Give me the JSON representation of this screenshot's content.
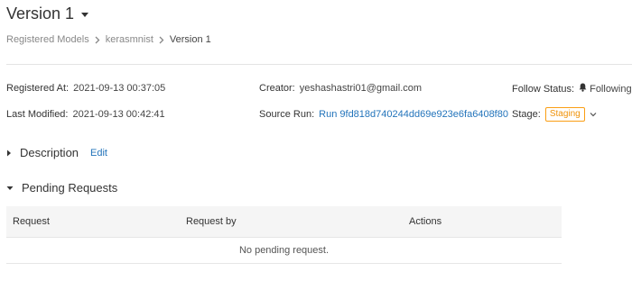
{
  "header": {
    "title": "Version 1"
  },
  "breadcrumb": {
    "items": [
      "Registered Models",
      "kerasmnist",
      "Version 1"
    ]
  },
  "metadata": {
    "registered_at": {
      "label": "Registered At:",
      "value": "2021-09-13 00:37:05"
    },
    "last_modified": {
      "label": "Last Modified:",
      "value": "2021-09-13 00:42:41"
    },
    "creator": {
      "label": "Creator:",
      "value": "yeshashastri01@gmail.com"
    },
    "source_run": {
      "label": "Source Run:",
      "value": "Run 9fd818d740244dd69e923e6fa6408f80"
    },
    "follow_status": {
      "label": "Follow Status:",
      "value": "Following"
    },
    "stage": {
      "label": "Stage:",
      "value": "Staging"
    }
  },
  "sections": {
    "description": {
      "title": "Description",
      "edit_label": "Edit"
    },
    "pending_requests": {
      "title": "Pending Requests"
    }
  },
  "table": {
    "columns": [
      "Request",
      "Request by",
      "Actions"
    ],
    "empty_text": "No pending request."
  },
  "colors": {
    "link": "#2374bb",
    "stage_badge": "#fa9e14",
    "table_header_bg": "#f5f5f5"
  },
  "icons": {
    "title_caret": "caret-down-icon",
    "breadcrumb_separator": "chevron-right-icon",
    "follow": "bell-icon",
    "stage_dropdown": "chevron-down-icon",
    "description_toggle": "caret-right-icon",
    "pending_toggle": "caret-down-icon"
  }
}
